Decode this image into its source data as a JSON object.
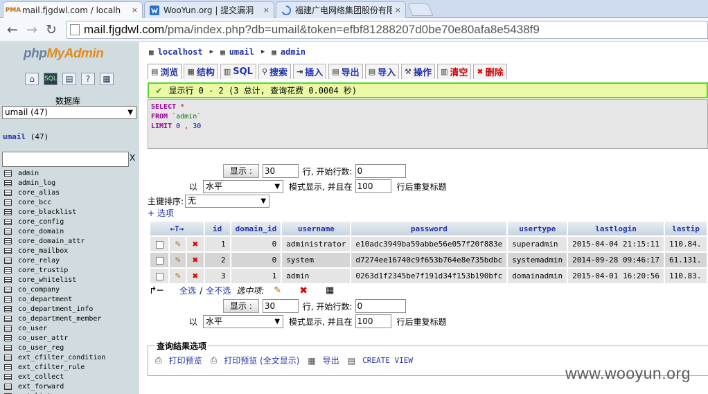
{
  "browser": {
    "tabs": [
      {
        "title": "mail.fjgdwl.com / localh",
        "favicon": "PMA",
        "active": true
      },
      {
        "title": "WooYun.org | 提交漏洞",
        "favicon": "wooyun-icon",
        "active": false
      },
      {
        "title": "福建广电网络集团股份有限",
        "favicon": "spinner-icon",
        "active": false
      }
    ],
    "close_glyph": "×",
    "url": {
      "host": "mail.fjgdwl.com",
      "path": "/pma/index.php?db=umail&token=efbf81288207d0be70e80afa8e5438f9"
    }
  },
  "sidebar": {
    "logo": {
      "a": "php",
      "b": "MyAdmin"
    },
    "db_label": "数据库",
    "db_select": "umail (47)",
    "db_name": "umail",
    "db_count": "(47)",
    "filter_clear": "X",
    "tables": [
      "admin",
      "admin_log",
      "core_alias",
      "core_bcc",
      "core_blacklist",
      "core_config",
      "core_domain",
      "core_domain_attr",
      "core_mailbox",
      "core_relay",
      "core_trustip",
      "core_whitelist",
      "co_company",
      "co_department",
      "co_department_info",
      "co_department_member",
      "co_user",
      "co_user_attr",
      "co_user_reg",
      "ext_cfilter_condition",
      "ext_cfilter_rule",
      "ext_collect",
      "ext_forward",
      "ext_list"
    ]
  },
  "breadcrumb": {
    "server": "localhost",
    "db": "umail",
    "table": "admin"
  },
  "tabs": [
    {
      "label": "浏览",
      "icon": "browse-icon",
      "glyph": "▤"
    },
    {
      "label": "结构",
      "icon": "structure-icon",
      "glyph": "▦"
    },
    {
      "label": "SQL",
      "icon": "sql-icon",
      "glyph": "▥"
    },
    {
      "label": "搜索",
      "icon": "search-icon",
      "glyph": "⚲"
    },
    {
      "label": "插入",
      "icon": "insert-icon",
      "glyph": "⇥"
    },
    {
      "label": "导出",
      "icon": "export-icon",
      "glyph": "▤"
    },
    {
      "label": "导入",
      "icon": "import-icon",
      "glyph": "▤"
    },
    {
      "label": "操作",
      "icon": "operations-icon",
      "glyph": "⚒"
    },
    {
      "label": "清空",
      "icon": "empty-icon",
      "glyph": "▥"
    },
    {
      "label": "删除",
      "icon": "drop-icon",
      "glyph": "✖"
    }
  ],
  "notice": "显示行 0 - 2 (3 总计, 查询花费 0.0004 秒)",
  "sql": {
    "select": "SELECT",
    "star": "*",
    "from": "FROM",
    "table": "`admin`",
    "limit": "LIMIT",
    "offset": "0",
    "comma": ",",
    "count": "30"
  },
  "nav": {
    "show_button": "显示 :",
    "rows_value": "30",
    "start_label": "行, 开始行数:",
    "start_value": "0",
    "mode_prefix": "以",
    "mode_value": "水平",
    "mode_label": "模式显示, 并且在",
    "repeat_value": "100",
    "repeat_label": "行后重复标题"
  },
  "sort": {
    "label": "主键排序:",
    "value": "无"
  },
  "options_link": "+ 选项",
  "table": {
    "sort_arrows": "←T→",
    "columns": [
      "id",
      "domain_id",
      "username",
      "password",
      "usertype",
      "lastlogin",
      "lastip"
    ],
    "rows": [
      {
        "id": "1",
        "domain_id": "0",
        "username": "administrator",
        "password": "e10adc3949ba59abbe56e057f20f883e",
        "usertype": "superadmin",
        "lastlogin": "2015-04-04 21:15:11",
        "lastip": "110.84."
      },
      {
        "id": "2",
        "domain_id": "0",
        "username": "system",
        "password": "d7274ee16740c9f653b764e8e735bdbc",
        "usertype": "systemadmin",
        "lastlogin": "2014-09-28 09:46:17",
        "lastip": "61.131."
      },
      {
        "id": "3",
        "domain_id": "1",
        "username": "admin",
        "password": "0263d1f2345be7f191d34f153b190bfc",
        "usertype": "domainadmin",
        "lastlogin": "2015-04-01 16:20:56",
        "lastip": "110.83."
      }
    ]
  },
  "bulk": {
    "check_all": "全选",
    "sep": "/",
    "uncheck_all": "全不选",
    "with_selected": "选中项:"
  },
  "query_results": {
    "legend": "查询结果选项",
    "print": "打印预览",
    "print_full": "打印预览 (全文显示)",
    "export": "导出",
    "create_view": "CREATE VIEW"
  },
  "watermark": "www.wooyun.org"
}
